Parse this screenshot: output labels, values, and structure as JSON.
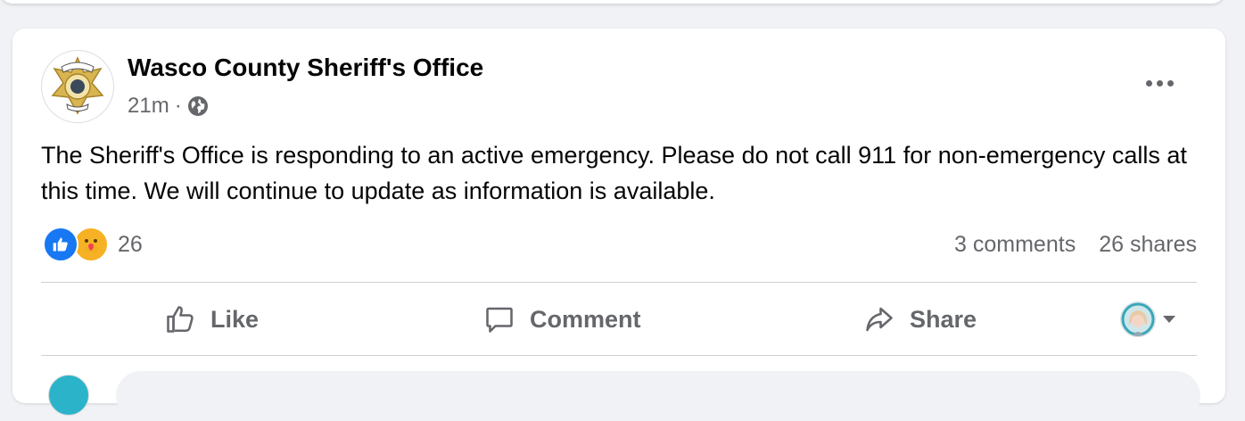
{
  "post": {
    "page_name": "Wasco County Sheriff's Office",
    "time": "21m",
    "separator": "·",
    "audience_icon": "globe-icon",
    "body": "The Sheriff's Office is responding to an active emergency. Please do not call 911 for non-emergency calls at this time. We will continue to update as information is available.",
    "avatar_badge_text": [
      "SHERIFF'S OFFICE",
      "WASCO",
      "COUNTY"
    ]
  },
  "reactions": {
    "icons": [
      "like-reaction-icon",
      "care-reaction-icon"
    ],
    "count": "26",
    "comments": "3 comments",
    "shares": "26 shares"
  },
  "actions": {
    "like_label": "Like",
    "comment_label": "Comment",
    "share_label": "Share"
  },
  "colors": {
    "like_blue": "#1877f2",
    "care_yellow": "#f7b125",
    "secondary_text": "#65676b",
    "primary_text": "#050505"
  }
}
